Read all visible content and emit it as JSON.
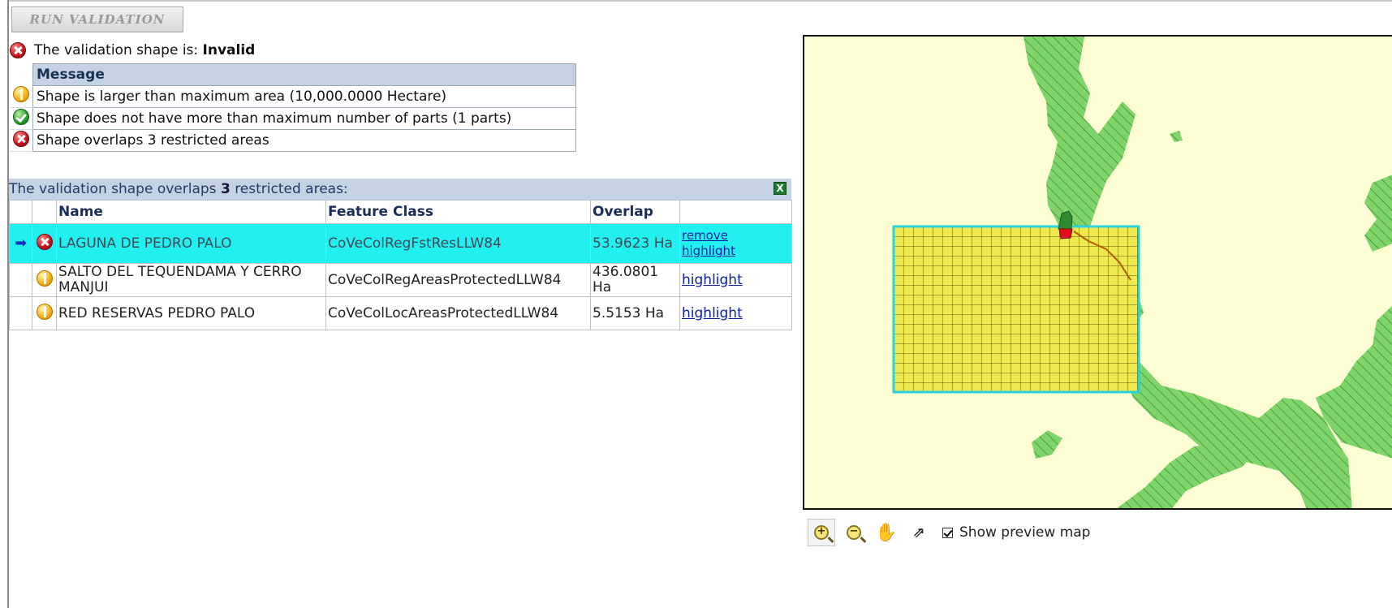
{
  "toolbar": {
    "run_validation_label": "RUN VALIDATION"
  },
  "status": {
    "prefix": "The validation shape is:",
    "value": "Invalid",
    "icon": "error-icon"
  },
  "messages": {
    "header": "Message",
    "rows": [
      {
        "icon": "warning-icon",
        "text": "Shape is larger than maximum area (10,000.0000 Hectare)"
      },
      {
        "icon": "success-icon",
        "text": "Shape does not have more than maximum number of parts (1 parts)"
      },
      {
        "icon": "error-icon",
        "text": "Shape overlaps 3 restricted areas"
      }
    ]
  },
  "overlaps": {
    "header_prefix": "The validation shape overlaps",
    "header_count": "3",
    "header_suffix": "restricted areas:",
    "export_icon": "excel-export-icon",
    "columns": [
      "Name",
      "Feature Class",
      "Overlap"
    ],
    "rows": [
      {
        "selected": true,
        "icon": "error-icon",
        "name": "LAGUNA DE PEDRO PALO",
        "feature_class": "CoVeColRegFstResLLW84",
        "overlap": "53.9623 Ha",
        "link1": "remove",
        "link2": "highlight"
      },
      {
        "selected": false,
        "icon": "warning-icon",
        "name": "SALTO DEL TEQUENDAMA Y CERRO MANJUI",
        "feature_class": "CoVeColRegAreasProtectedLLW84",
        "overlap": "436.0801 Ha",
        "link1": "highlight"
      },
      {
        "selected": false,
        "icon": "warning-icon",
        "name": "RED RESERVAS PEDRO PALO",
        "feature_class": "CoVeColLocAreasProtectedLLW84",
        "overlap": "5.5153 Ha",
        "link1": "highlight"
      }
    ]
  },
  "map": {
    "colors": {
      "background": "#fdfdd4",
      "land": "#7fd46a",
      "hatch": "#58b048",
      "shape_fill": "#efe84f",
      "shape_border": "#29d3dd",
      "grid": "#5e5a10",
      "overlap_red": "#e0101a"
    },
    "tools": [
      "zoom-in-icon",
      "zoom-out-icon",
      "pan-hand-icon",
      "popout-icon"
    ],
    "show_preview_label": "Show preview map",
    "show_preview_checked": true
  }
}
